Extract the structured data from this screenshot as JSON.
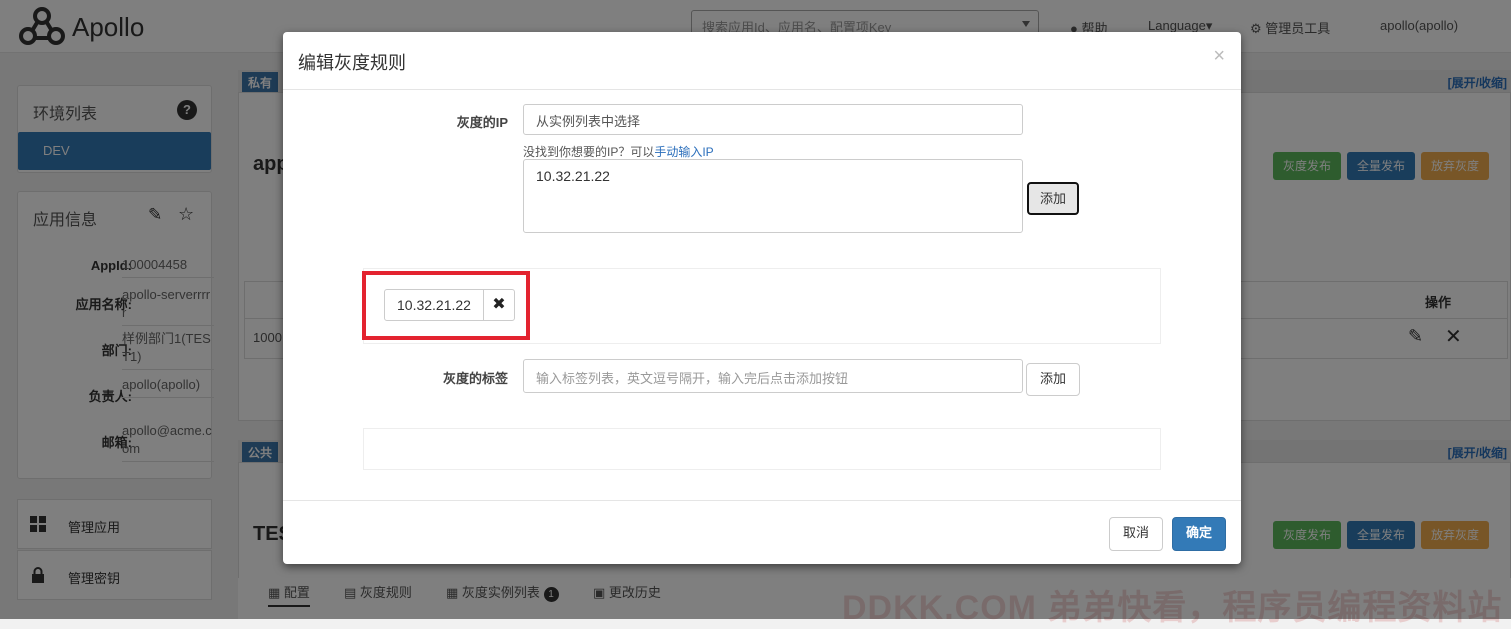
{
  "app": {
    "logo_text": "Apollo"
  },
  "topbar": {
    "search_placeholder": "搜索应用Id、应用名、配置项Key",
    "help": "帮助",
    "language": "Language▾",
    "admin": "管理员工具",
    "user": "apollo(apollo)"
  },
  "sidebar": {
    "env_title": "环境列表",
    "env_item": "DEV",
    "info_title": "应用信息",
    "info": [
      {
        "label": "AppId:",
        "value": "100004458"
      },
      {
        "label": "应用名称:",
        "value": "apollo-serverrrrr"
      },
      {
        "label": "部门:",
        "value": "样例部门1(TEST1)"
      },
      {
        "label": "负责人:",
        "value": "apollo(apollo)"
      },
      {
        "label": "邮箱:",
        "value": "apollo@acme.com"
      }
    ],
    "menu": [
      {
        "label": "管理应用"
      },
      {
        "label": "管理密钥"
      }
    ]
  },
  "background": {
    "private_tag": "私有",
    "public_tag": "公共",
    "expand": "[展开/收缩]",
    "ns1_title": "app",
    "ns2_title": "TES",
    "gray_publish": "灰度发布",
    "full_publish": "全量发布",
    "abandon_gray": "放弃灰度",
    "table_header_ops": "操作",
    "table_row_prefix": "1000",
    "tabs": [
      {
        "label": "配置"
      },
      {
        "label": "灰度规则"
      },
      {
        "label": "灰度实例列表",
        "badge": "1"
      },
      {
        "label": "更改历史"
      }
    ],
    "watermark": "DDKK.COM 弟弟快看，程序员编程资料站"
  },
  "modal": {
    "title": "编辑灰度规则",
    "close": "×",
    "gray_ip_label": "灰度的IP",
    "ip_select_value": "从实例列表中选择",
    "hint_text": "没找到你想要的IP？可以",
    "hint_link": "手动输入IP",
    "ip_textarea_value": "10.32.21.22",
    "add_button": "添加",
    "selected_ip": "10.32.21.22",
    "remove_icon": "✖",
    "gray_label_label": "灰度的标签",
    "label_placeholder": "输入标签列表，英文逗号隔开，输入完后点击添加按钮",
    "label_add_button": "添加",
    "cancel_button": "取消",
    "ok_button": "确定"
  },
  "colors": {
    "primary": "#337ab7",
    "green": "#5cb85c",
    "orange": "#f0ad4e",
    "highlight": "#e3232f"
  }
}
